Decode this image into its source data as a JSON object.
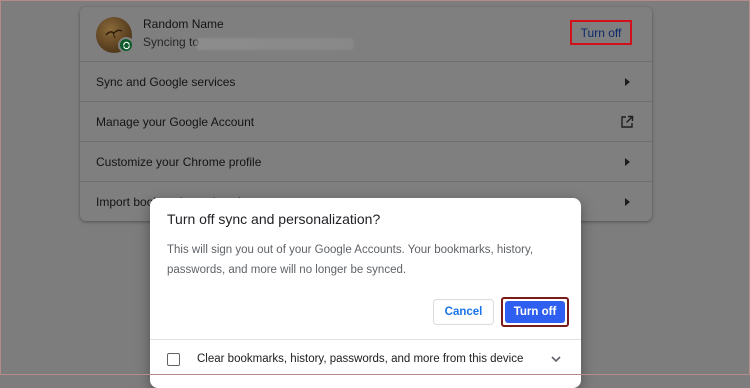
{
  "profile": {
    "name": "Random Name",
    "sync_status": "Syncing to",
    "turn_off_label": "Turn off"
  },
  "settings_items": [
    {
      "label": "Sync and Google services",
      "icon": "chevron-right-icon"
    },
    {
      "label": "Manage your Google Account",
      "icon": "external-link-icon"
    },
    {
      "label": "Customize your Chrome profile",
      "icon": "chevron-right-icon"
    },
    {
      "label": "Import bookmarks and settings",
      "icon": "chevron-right-icon"
    }
  ],
  "dialog": {
    "title": "Turn off sync and personalization?",
    "body": "This will sign you out of your Google Accounts. Your bookmarks, history, passwords, and more will no longer be synced.",
    "cancel_label": "Cancel",
    "confirm_label": "Turn off",
    "checkbox_label": "Clear bookmarks, history, passwords, and more from this device",
    "checkbox_checked": false
  },
  "colors": {
    "accent": "#1a73e8",
    "confirm_button": "#2f5ff0",
    "highlight_border": "#d0101a",
    "overlay": "#7d7d7d"
  }
}
